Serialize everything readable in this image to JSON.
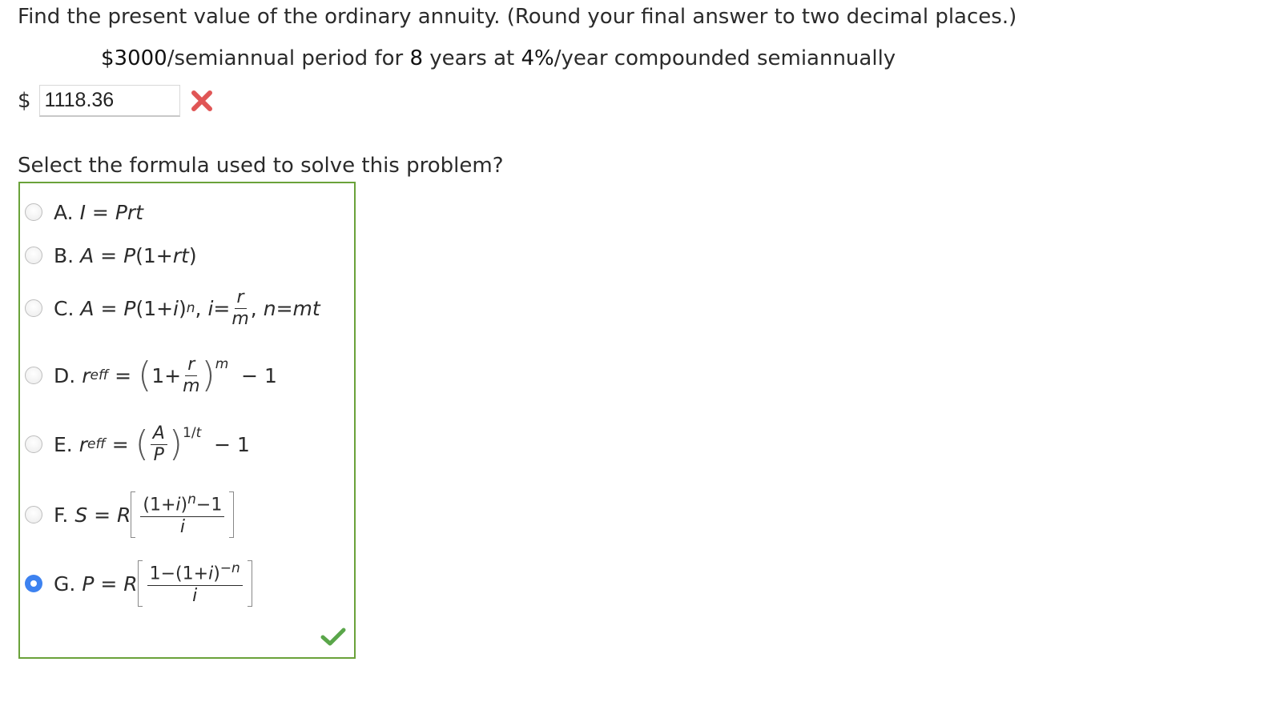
{
  "question": {
    "text": "Find the present value of the ordinary annuity. (Round your final answer to two decimal places.)"
  },
  "givens": {
    "payment": "$3000",
    "period_text": "/semiannual period for ",
    "years": "8",
    "years_text": " years at ",
    "rate": "4%",
    "rate_text": "/year compounded semiannually"
  },
  "answer": {
    "currency": "$",
    "value": "1118.36",
    "status": "incorrect"
  },
  "prompt": {
    "text": "Select the formula used to solve this problem?"
  },
  "choices": {
    "selected": "G",
    "status": "correct",
    "items": [
      {
        "letter": "A."
      },
      {
        "letter": "B."
      },
      {
        "letter": "C."
      },
      {
        "letter": "D."
      },
      {
        "letter": "E."
      },
      {
        "letter": "F."
      },
      {
        "letter": "G."
      }
    ]
  },
  "colors": {
    "accent": "#3d82f0",
    "correct": "#6aa23a",
    "incorrect": "#e05656"
  }
}
